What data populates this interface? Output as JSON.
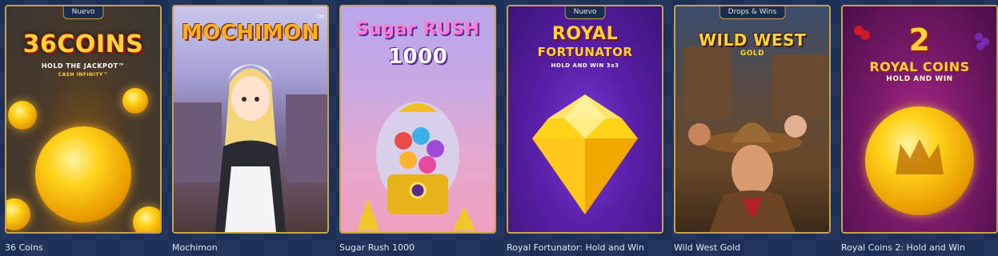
{
  "games": [
    {
      "title": "36 Coins",
      "badge": "Nuevo",
      "logo_main": "36COINS",
      "logo_sub1": "HOLD THE JACKPOT™",
      "logo_sub2": "CASH INFINITY™"
    },
    {
      "title": "Mochimon",
      "badge": "",
      "logo_main": "MOCHIMON",
      "logo_sub1": "TM",
      "logo_sub2": ""
    },
    {
      "title": "Sugar Rush 1000",
      "badge": "",
      "logo_main": "Sugar RUSH",
      "logo_sub1": "1000",
      "logo_sub2": ""
    },
    {
      "title": "Royal Fortunator: Hold and Win",
      "badge": "Nuevo",
      "logo_main": "ROYAL",
      "logo_sub1": "FORTUNATOR",
      "logo_sub2": "HOLD AND WIN 3x3"
    },
    {
      "title": "Wild West Gold",
      "badge": "Drops & Wins",
      "logo_main": "WILD WEST",
      "logo_sub1": "GOLD",
      "logo_sub2": ""
    },
    {
      "title": "Royal Coins 2: Hold and Win",
      "badge": "",
      "logo_main": "2",
      "logo_sub1": "ROYAL COINS",
      "logo_sub2": "HOLD AND WIN"
    }
  ],
  "colors": {
    "background": "#1c2f57",
    "frame": "#c9a24a",
    "title_text": "#e6e6ee"
  }
}
